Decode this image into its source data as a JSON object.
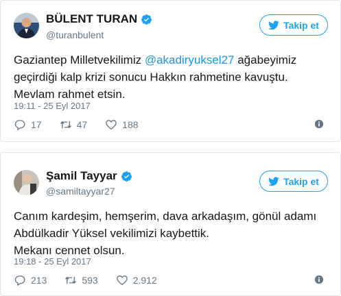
{
  "colors": {
    "accent": "#1da1f2",
    "mention": "#1b95e0",
    "muted": "#657786",
    "text": "#14171a"
  },
  "tweets": [
    {
      "name": "BÜLENT TURAN",
      "handle": "@turanbulent",
      "follow_label": "Takip et",
      "text_before": "Gaziantep Milletvekilimiz ",
      "mention": "@akadiryuksel27",
      "text_after": " ağabeyimiz geçirdiği kalp krizi sonucu Hakkın rahmetine kavuştu. Mevlam rahmet etsin.",
      "timestamp": "19:11 - 25 Eyl 2017",
      "replies": "17",
      "retweets": "47",
      "likes": "188",
      "icons": [
        "verified-icon",
        "twitter-bird-icon",
        "reply-icon",
        "retweet-icon",
        "heart-icon",
        "info-icon"
      ]
    },
    {
      "name": "Şamil Tayyar",
      "handle": "@samiltayyar27",
      "follow_label": "Takip et",
      "text_lines": [
        "Canım kardeşim, hemşerim, dava arkadaşım, gönül adamı",
        "Abdülkadir Yüksel vekilimizi kaybettik.",
        "Mekanı cennet olsun."
      ],
      "timestamp": "19:18 - 25 Eyl 2017",
      "replies": "213",
      "retweets": "593",
      "likes": "2.912",
      "icons": [
        "verified-icon",
        "twitter-bird-icon",
        "reply-icon",
        "retweet-icon",
        "heart-icon",
        "info-icon"
      ]
    }
  ]
}
